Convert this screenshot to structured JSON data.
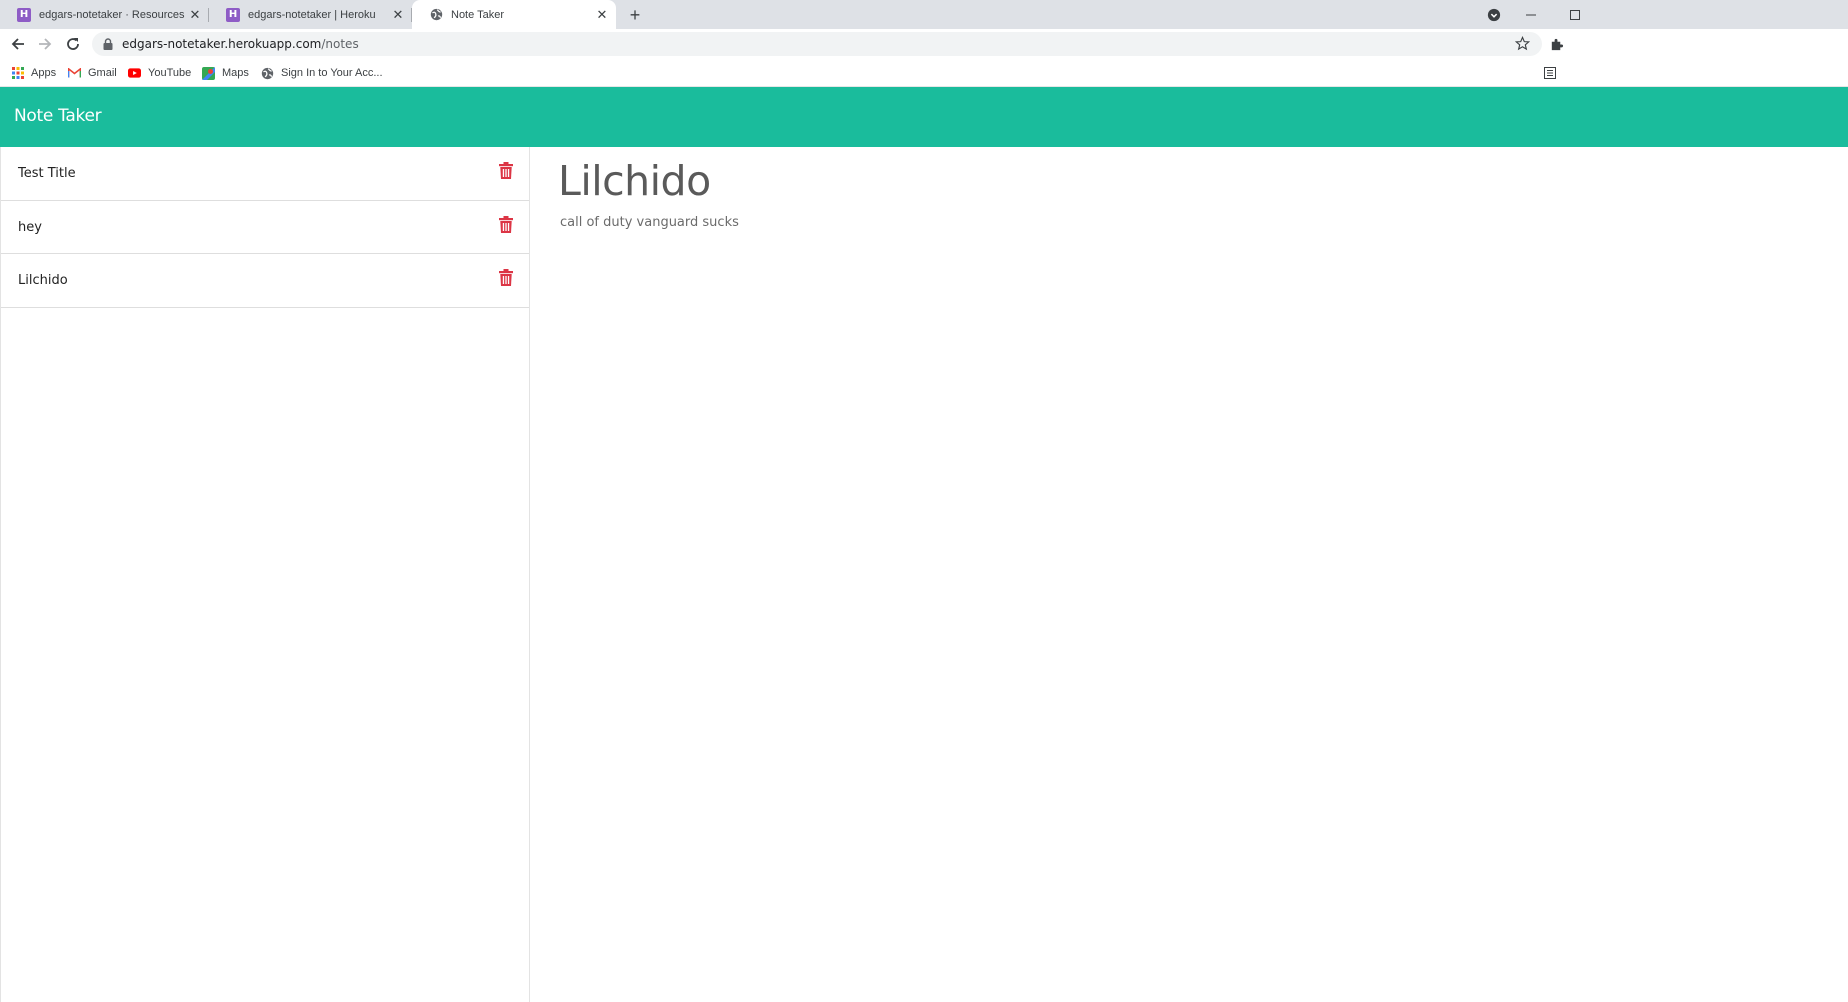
{
  "browser": {
    "tabs": [
      {
        "title": "edgars-notetaker · Resources | Heroku",
        "favicon": "heroku-icon",
        "active": false
      },
      {
        "title": "edgars-notetaker | Heroku",
        "favicon": "heroku-icon",
        "active": false
      },
      {
        "title": "Note Taker",
        "favicon": "globe-icon",
        "active": true
      }
    ],
    "url_host": "edgars-notetaker.herokuapp.com",
    "url_path": "/notes",
    "bookmarks": [
      {
        "label": "Apps",
        "icon": "apps-grid-icon"
      },
      {
        "label": "Gmail",
        "icon": "gmail-icon"
      },
      {
        "label": "YouTube",
        "icon": "youtube-icon"
      },
      {
        "label": "Maps",
        "icon": "maps-icon"
      },
      {
        "label": "Sign In to Your Acc...",
        "icon": "globe-icon"
      }
    ]
  },
  "app": {
    "brand": "Note Taker",
    "accent_color": "#1abc9c",
    "delete_color": "#dc3545",
    "notes": [
      {
        "title": "Test Title"
      },
      {
        "title": "hey"
      },
      {
        "title": "Lilchido"
      }
    ],
    "active_note": {
      "title": "Lilchido",
      "text": "call of duty vanguard sucks"
    }
  }
}
